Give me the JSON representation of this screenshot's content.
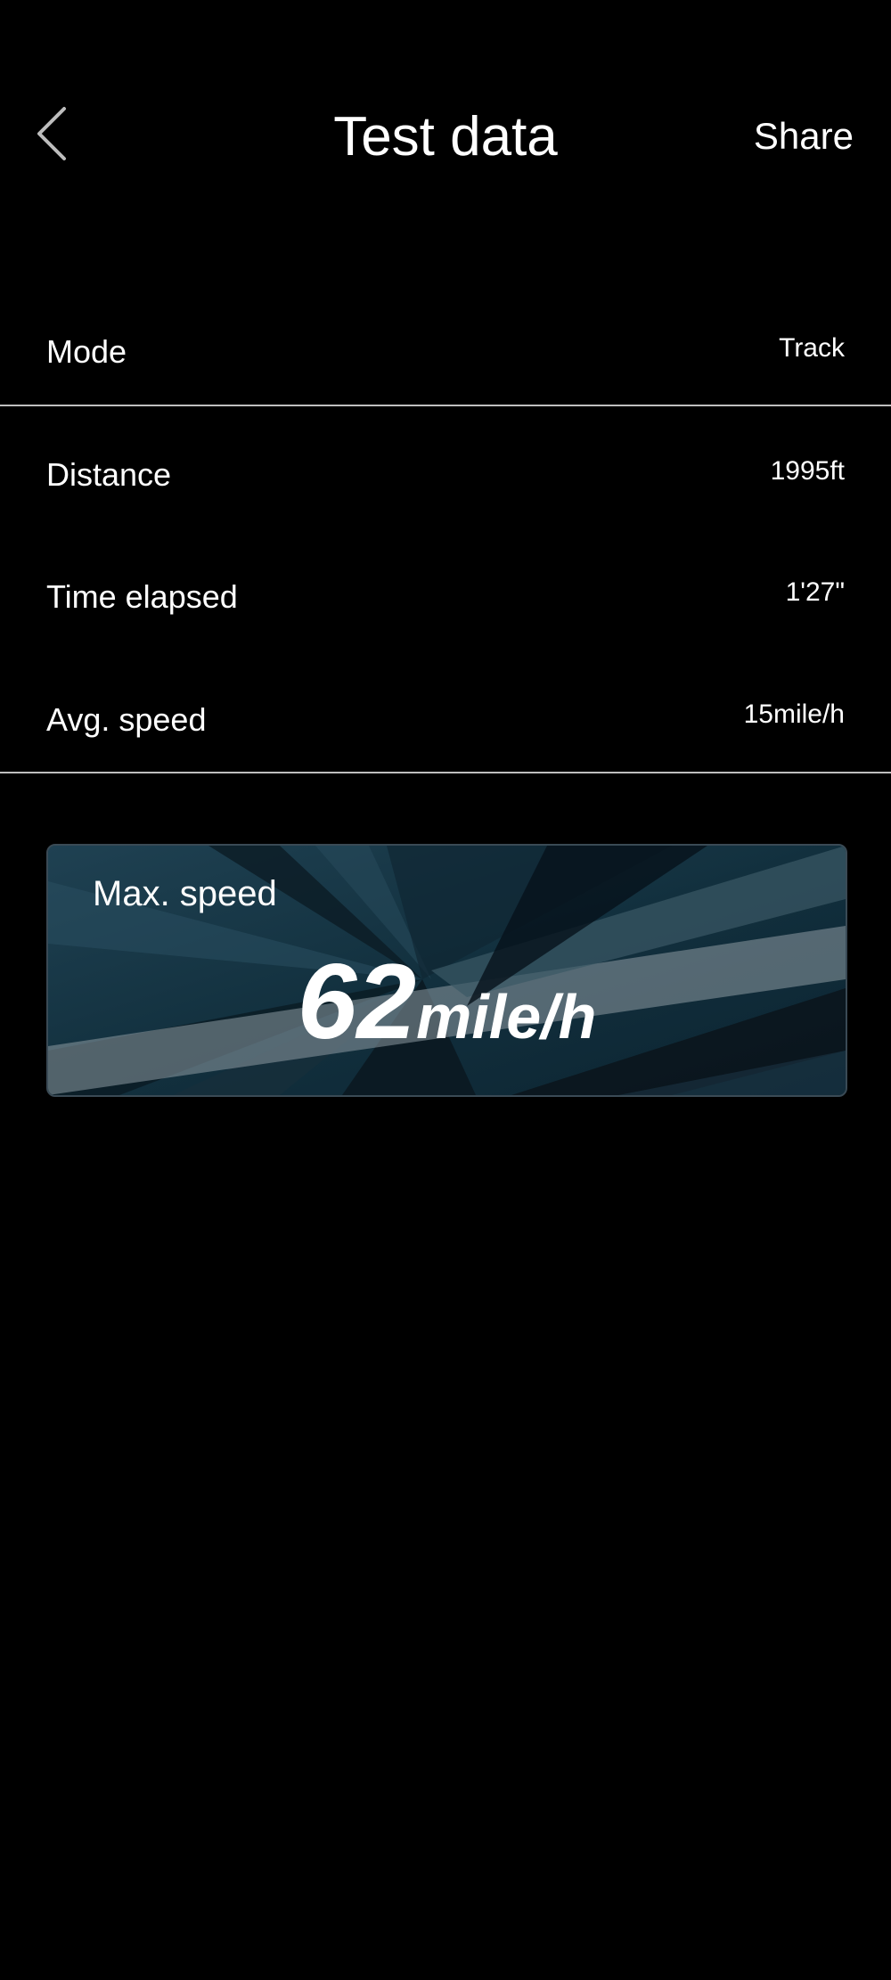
{
  "header": {
    "title": "Test data",
    "share_label": "Share",
    "back_icon": "chevron-left-icon"
  },
  "rows": [
    {
      "label": "Mode",
      "value": "Track"
    },
    {
      "label": "Distance",
      "value": "1995ft"
    },
    {
      "label": "Time elapsed",
      "value": "1'27\""
    },
    {
      "label": "Avg. speed",
      "value": "15mile/h"
    }
  ],
  "max_speed": {
    "label": "Max. speed",
    "value": "62",
    "unit": "mile/h"
  },
  "colors": {
    "background": "#000000",
    "text": "#ffffff",
    "divider": "#bfbfbf",
    "card_base": "#163240"
  }
}
